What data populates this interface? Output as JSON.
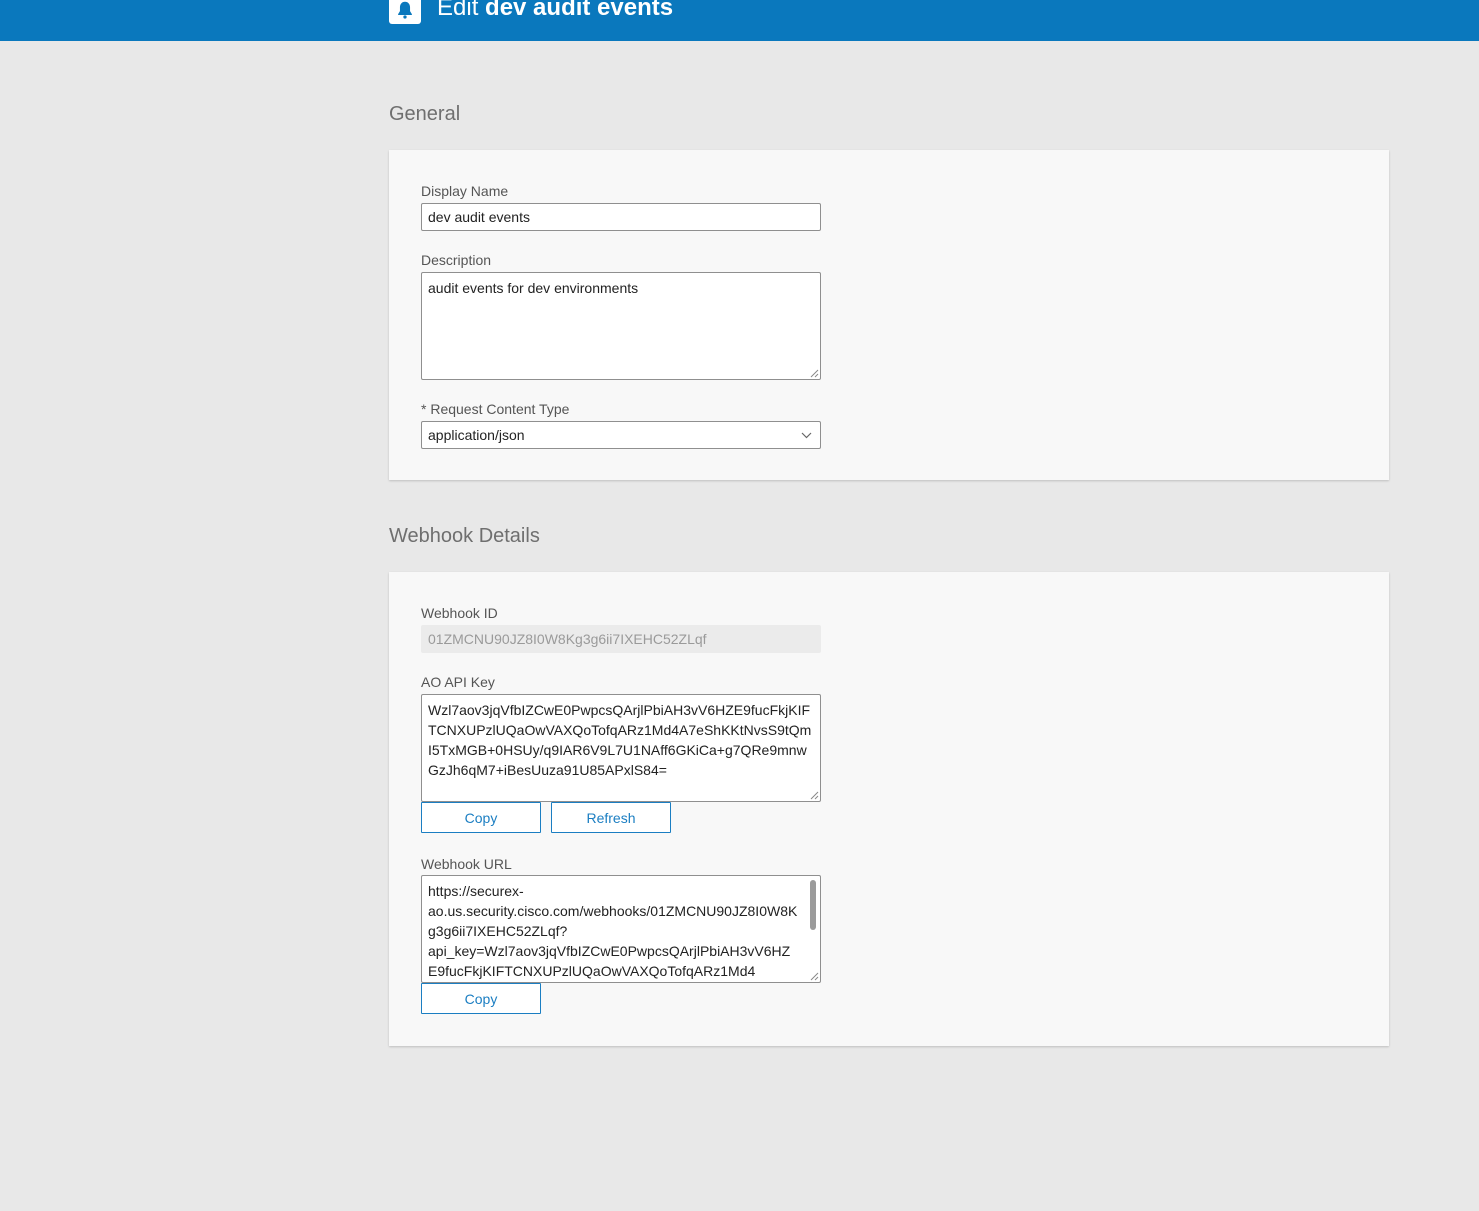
{
  "header": {
    "title_prefix": "Edit",
    "title_name": "dev audit events",
    "icon": "bell-icon",
    "bar_color": "#0a78bd"
  },
  "general": {
    "section_title": "General",
    "display_name": {
      "label": "Display Name",
      "value": "dev audit events"
    },
    "description": {
      "label": "Description",
      "value": "audit events for dev environments"
    },
    "content_type": {
      "label": "* Request Content Type",
      "value": "application/json"
    }
  },
  "webhook": {
    "section_title": "Webhook Details",
    "webhook_id": {
      "label": "Webhook ID",
      "value": "01ZMCNU90JZ8I0W8Kg3g6ii7IXEHC52ZLqf"
    },
    "api_key": {
      "label": "AO API Key",
      "value": "Wzl7aov3jqVfbIZCwE0PwpcsQArjlPbiAH3vV6HZE9fucFkjKIFTCNXUPzlUQaOwVAXQoTofqARz1Md4A7eShKKtNvsS9tQmI5TxMGB+0HSUy/q9IAR6V9L7U1NAff6GKiCa+g7QRe9mnwGzJh6qM7+iBesUuza91U85APxlS84=",
      "copy_label": "Copy",
      "refresh_label": "Refresh"
    },
    "url": {
      "label": "Webhook URL",
      "value": "https://securex-\nao.us.security.cisco.com/webhooks/01ZMCNU90JZ8I0W8Kg3g6ii7IXEHC52ZLqf?\napi_key=Wzl7aov3jqVfbIZCwE0PwpcsQArjlPbiAH3vV6HZE9fucFkjKIFTCNXUPzlUQaOwVAXQoTofqARz1Md4",
      "copy_label": "Copy"
    },
    "accent_color": "#1b7ec2"
  }
}
